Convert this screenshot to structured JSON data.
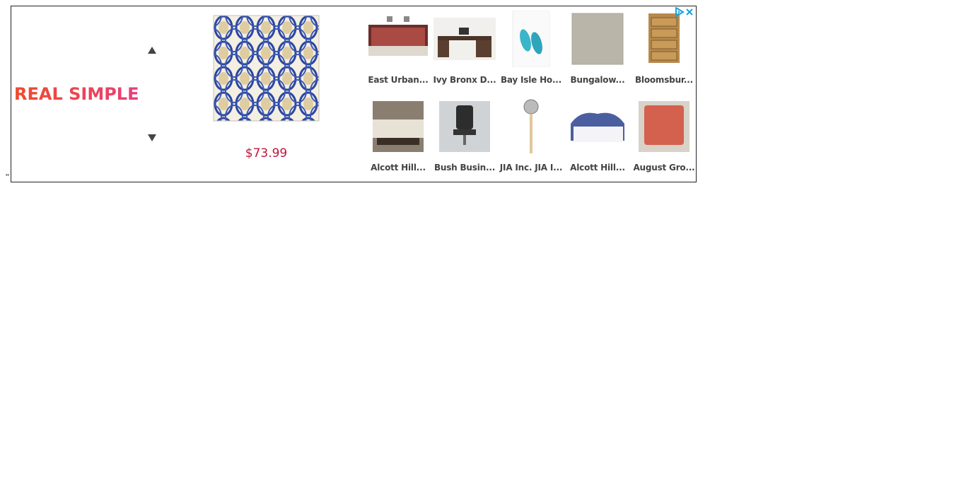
{
  "stray_text": "\"",
  "ad": {
    "brand": "REAL SIMPLE",
    "brand_colors": {
      "gradient_start": "#f04a2a",
      "gradient_end": "#e8407a"
    },
    "up_arrow_icon": "triangle-up-icon",
    "down_arrow_icon": "triangle-down-icon",
    "featured": {
      "price": "$73.99",
      "price_color": "#c0143c"
    },
    "adchoices_icon": "adchoices-play-icon",
    "close_icon": "close-x-icon",
    "accent_color": "#1aa3dc",
    "products": [
      {
        "label": "East Urban..."
      },
      {
        "label": "Ivy Bronx D..."
      },
      {
        "label": "Bay Isle Ho..."
      },
      {
        "label": "Bungalow..."
      },
      {
        "label": "Bloomsbur..."
      },
      {
        "label": "Alcott Hill..."
      },
      {
        "label": "Bush Busin..."
      },
      {
        "label": "JIA Inc. JIA I..."
      },
      {
        "label": "Alcott Hill..."
      },
      {
        "label": "August Gro..."
      }
    ]
  }
}
